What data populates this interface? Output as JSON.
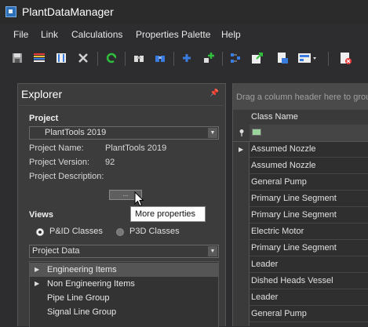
{
  "window": {
    "title": "PlantDataManager",
    "icon": "app-icon"
  },
  "menu": [
    "File",
    "Link",
    "Calculations",
    "Properties Palette",
    "Help"
  ],
  "toolbar": {
    "icons": [
      "save-icon",
      "list-bars-icon",
      "columns-icon",
      "delete-icon",
      "refresh-icon",
      "binoculars-icon",
      "binoculars-blue-icon",
      "add-icon",
      "add-green-icon",
      "tree-icon",
      "export-icon",
      "import-icon",
      "layout-dropdown-icon",
      "report-icon"
    ]
  },
  "explorer": {
    "title": "Explorer",
    "pin": "pin-icon",
    "project_section": "Project",
    "project_combo": "PlantTools 2019",
    "project_name_label": "Project Name:",
    "project_name_value": "PlantTools 2019",
    "project_version_label": "Project Version:",
    "project_version_value": "92",
    "project_description_label": "Project Description:",
    "more_button": "...",
    "tooltip": "More properties",
    "views_section": "Views",
    "radio_pid": "P&ID Classes",
    "radio_p3d": "P3D Classes",
    "radio_selected": "P&ID Classes",
    "data_combo": "Project Data",
    "tree": [
      {
        "label": "Engineering Items",
        "expandable": true,
        "selected": true
      },
      {
        "label": "Non Engineering Items",
        "expandable": true,
        "selected": false
      },
      {
        "label": "Pipe Line Group",
        "expandable": false,
        "selected": false
      },
      {
        "label": "Signal Line Group",
        "expandable": false,
        "selected": false
      }
    ]
  },
  "grid": {
    "group_placeholder": "Drag a column header here to grou",
    "column": "Class Name",
    "rows": [
      "Assumed Nozzle",
      "Assumed Nozzle",
      "General Pump",
      "Primary Line Segment",
      "Primary Line Segment",
      "Electric Motor",
      "Primary Line Segment",
      "Leader",
      "Dished Heads Vessel",
      "Leader",
      "General Pump"
    ]
  },
  "colors": {
    "background": "#2d2d30",
    "panel": "#3c3c3c",
    "accent_green": "#2fbf3a",
    "accent_blue": "#3a7be0"
  }
}
